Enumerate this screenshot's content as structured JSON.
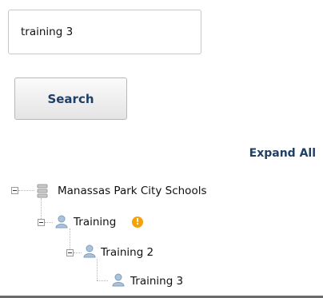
{
  "search": {
    "value": "training 3",
    "button_label": "Search"
  },
  "tree": {
    "expand_all_label": "Expand All",
    "nodes": [
      {
        "label": "Manassas Park City Schools",
        "icon": "server-icon",
        "level": 0,
        "expanded": true
      },
      {
        "label": "Training",
        "icon": "user-icon",
        "level": 1,
        "expanded": true,
        "badge": "!"
      },
      {
        "label": "Training 2",
        "icon": "user-icon",
        "level": 2,
        "expanded": true
      },
      {
        "label": "Training 3",
        "icon": "user-icon",
        "level": 3,
        "leaf": true
      }
    ]
  },
  "colors": {
    "link": "#1f3f66",
    "warning_badge": "#f5a20a"
  }
}
